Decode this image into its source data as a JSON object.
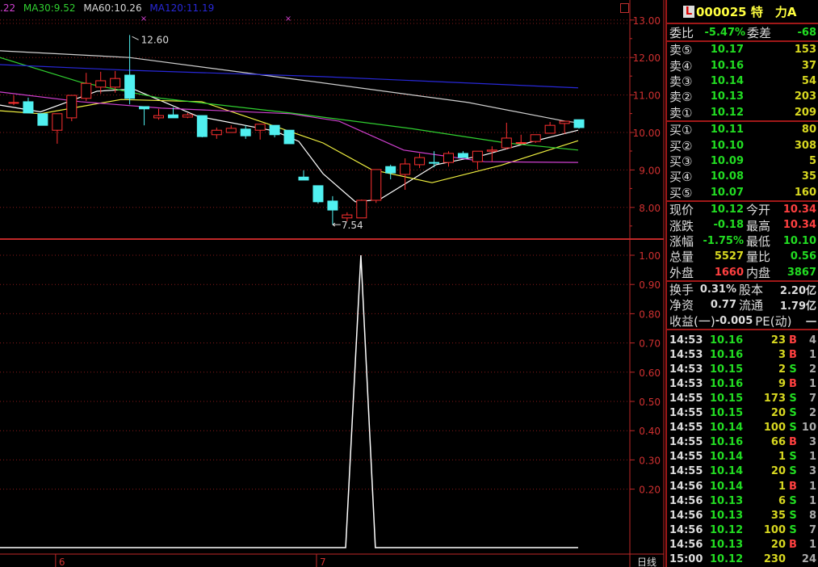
{
  "legend": [
    {
      "text": ".22",
      "color": "#d040d0"
    },
    {
      "text": "MA30:9.52",
      "color": "#30d030"
    },
    {
      "text": "MA60:10.26",
      "color": "#d8d8d8"
    },
    {
      "text": "MA120:11.19",
      "color": "#2020d0"
    }
  ],
  "colors": {
    "up": "#ff3030",
    "down": "#50f0f0",
    "axis": "#c02828",
    "grid": "#8a1a1a"
  },
  "chart_data": [
    {
      "type": "candlestick",
      "price_ticks": [
        "13.00",
        "12.00",
        "11.00",
        "10.00",
        "9.00",
        "8.00"
      ],
      "ylim": [
        7.3,
        13.5
      ],
      "x_labels": [
        {
          "text": "6",
          "index": 3
        },
        {
          "text": "7",
          "index": 21
        }
      ],
      "period_label": "日线",
      "high_marker": {
        "text": "12.60",
        "index": 8,
        "price": 12.6
      },
      "low_marker": {
        "text": "7.54",
        "index": 22,
        "price": 7.54
      },
      "candles": [
        [
          10.78,
          10.8,
          10.99,
          10.73
        ],
        [
          10.82,
          10.52,
          10.93,
          10.52
        ],
        [
          10.5,
          10.19,
          10.5,
          10.19
        ],
        [
          10.06,
          10.5,
          10.5,
          9.7
        ],
        [
          10.39,
          10.99,
          10.99,
          10.3
        ],
        [
          10.91,
          11.31,
          11.59,
          10.84
        ],
        [
          11.21,
          11.38,
          11.62,
          11.03
        ],
        [
          11.21,
          11.44,
          11.64,
          11.06
        ],
        [
          11.53,
          10.91,
          12.6,
          10.75
        ],
        [
          10.69,
          10.63,
          10.69,
          10.19
        ],
        [
          10.39,
          10.45,
          10.63,
          10.34
        ],
        [
          10.47,
          10.39,
          10.67,
          10.39
        ],
        [
          10.41,
          10.47,
          10.52,
          10.38
        ],
        [
          10.45,
          9.89,
          10.45,
          9.87
        ],
        [
          9.94,
          10.06,
          10.13,
          9.83
        ],
        [
          10.0,
          10.11,
          10.19,
          10.0
        ],
        [
          10.09,
          9.91,
          10.19,
          9.83
        ],
        [
          10.06,
          10.22,
          10.22,
          9.81
        ],
        [
          10.19,
          9.94,
          10.19,
          9.87
        ],
        [
          10.06,
          9.7,
          10.06,
          9.7
        ],
        [
          8.81,
          8.73,
          8.99,
          8.73
        ],
        [
          8.58,
          8.15,
          8.58,
          8.1
        ],
        [
          8.17,
          7.93,
          8.3,
          7.54
        ],
        [
          7.72,
          7.8,
          7.87,
          7.63
        ],
        [
          7.72,
          8.19,
          8.21,
          7.72
        ],
        [
          8.19,
          9.01,
          9.01,
          8.12
        ],
        [
          9.09,
          8.92,
          9.14,
          8.75
        ],
        [
          8.88,
          9.16,
          9.31,
          8.47
        ],
        [
          9.14,
          9.33,
          9.44,
          9.05
        ],
        [
          9.2,
          9.18,
          9.5,
          9.07
        ],
        [
          9.2,
          9.44,
          9.5,
          9.09
        ],
        [
          9.44,
          9.33,
          9.5,
          9.33
        ],
        [
          9.22,
          9.5,
          9.5,
          9.01
        ],
        [
          9.5,
          9.53,
          9.63,
          9.22
        ],
        [
          9.59,
          9.85,
          10.26,
          9.55
        ],
        [
          9.72,
          9.73,
          9.94,
          9.68
        ],
        [
          9.76,
          9.94,
          9.94,
          9.72
        ],
        [
          9.98,
          10.19,
          10.28,
          9.98
        ],
        [
          10.24,
          10.3,
          10.3,
          9.96
        ],
        [
          10.34,
          10.13,
          10.34,
          10.1
        ]
      ],
      "ma_series": [
        {
          "name": "MA5",
          "color": "#ffffff",
          "points": [
            [
              -0.95,
              10.73
            ],
            [
              1.84,
              10.55
            ],
            [
              5.74,
              11.1
            ],
            [
              8.25,
              11.16
            ],
            [
              12.7,
              10.43
            ],
            [
              18.0,
              10.04
            ],
            [
              19.67,
              9.76
            ],
            [
              21.34,
              8.9
            ],
            [
              23.57,
              8.15
            ],
            [
              25.24,
              8.21
            ],
            [
              29.14,
              9.14
            ],
            [
              32.48,
              9.4
            ],
            [
              35.82,
              9.76
            ],
            [
              38.94,
              10.06
            ]
          ]
        },
        {
          "name": "MA10",
          "color": "#f0f040",
          "points": [
            [
              -0.95,
              10.58
            ],
            [
              1.84,
              10.5
            ],
            [
              4.62,
              10.69
            ],
            [
              7.41,
              10.88
            ],
            [
              12.98,
              10.82
            ],
            [
              17.44,
              10.24
            ],
            [
              21.34,
              9.72
            ],
            [
              24.68,
              9.01
            ],
            [
              28.86,
              8.66
            ],
            [
              33.59,
              9.12
            ],
            [
              38.94,
              9.78
            ]
          ]
        },
        {
          "name": "MA20",
          "color": "#d040d0",
          "points": [
            [
              -0.95,
              11.08
            ],
            [
              4.62,
              10.82
            ],
            [
              10.2,
              10.65
            ],
            [
              19.1,
              10.5
            ],
            [
              22.45,
              10.3
            ],
            [
              26.9,
              9.53
            ],
            [
              32.48,
              9.22
            ],
            [
              38.94,
              9.2
            ]
          ]
        },
        {
          "name": "MA30",
          "color": "#30d030",
          "points": [
            [
              -0.95,
              12.0
            ],
            [
              4.62,
              11.34
            ],
            [
              10.2,
              10.91
            ],
            [
              19.1,
              10.52
            ],
            [
              27.5,
              10.1
            ],
            [
              33.98,
              9.72
            ],
            [
              38.94,
              9.53
            ]
          ]
        },
        {
          "name": "MA60",
          "color": "#d0d0d0",
          "points": [
            [
              -0.95,
              12.18
            ],
            [
              7.97,
              12.0
            ],
            [
              20.2,
              11.38
            ],
            [
              31.36,
              10.8
            ],
            [
              38.05,
              10.3
            ],
            [
              38.94,
              10.26
            ]
          ]
        },
        {
          "name": "MA120",
          "color": "#2828d8",
          "points": [
            [
              -0.95,
              11.81
            ],
            [
              7.97,
              11.66
            ],
            [
              21.34,
              11.49
            ],
            [
              38.94,
              11.19
            ]
          ]
        }
      ]
    },
    {
      "type": "line",
      "ticks": [
        "1.00",
        "0.90",
        "0.80",
        "0.70",
        "0.60",
        "0.50",
        "0.40",
        "0.30",
        "0.20"
      ],
      "ylim": [
        0,
        1.0
      ],
      "series": [
        {
          "name": "indicator",
          "color": "#ffffff",
          "points": [
            [
              -0.95,
              0
            ],
            [
              22.9,
              0
            ],
            [
              23.95,
              1.0
            ],
            [
              24.95,
              0
            ],
            [
              38.94,
              0
            ]
          ]
        }
      ]
    }
  ],
  "panel": {
    "logo": "L",
    "code": "000025 特　力A",
    "weibi_label": "委比",
    "weibi": "-5.47%",
    "weicha_label": "委差",
    "weicha": "-68",
    "sell": [
      {
        "label": "卖⑤",
        "price": "10.17",
        "vol": "153"
      },
      {
        "label": "卖④",
        "price": "10.16",
        "vol": "37"
      },
      {
        "label": "卖③",
        "price": "10.14",
        "vol": "54"
      },
      {
        "label": "卖②",
        "price": "10.13",
        "vol": "203"
      },
      {
        "label": "卖①",
        "price": "10.12",
        "vol": "209"
      }
    ],
    "buy": [
      {
        "label": "买①",
        "price": "10.11",
        "vol": "80"
      },
      {
        "label": "买②",
        "price": "10.10",
        "vol": "308"
      },
      {
        "label": "买③",
        "price": "10.09",
        "vol": "5"
      },
      {
        "label": "买④",
        "price": "10.08",
        "vol": "35"
      },
      {
        "label": "买⑤",
        "price": "10.07",
        "vol": "160"
      }
    ],
    "stats": [
      {
        "l1": "现价",
        "v1": "10.12",
        "c1": "g",
        "l2": "今开",
        "v2": "10.34",
        "c2": "r"
      },
      {
        "l1": "涨跌",
        "v1": "-0.18",
        "c1": "g",
        "l2": "最高",
        "v2": "10.34",
        "c2": "r"
      },
      {
        "l1": "涨幅",
        "v1": "-1.75%",
        "c1": "g",
        "l2": "最低",
        "v2": "10.10",
        "c2": "g"
      },
      {
        "l1": "总量",
        "v1": "5527",
        "c1": "y",
        "l2": "量比",
        "v2": "0.56",
        "c2": "g"
      },
      {
        "l1": "外盘",
        "v1": "1660",
        "c1": "r",
        "l2": "内盘",
        "v2": "3867",
        "c2": "g"
      }
    ],
    "fin": [
      {
        "l1": "换手",
        "v1": "0.31%",
        "l2": "股本",
        "v2": "2.20亿"
      },
      {
        "l1": "净资",
        "v1": "0.77",
        "l2": "流通",
        "v2": "1.79亿"
      },
      {
        "l1": "收益(一)",
        "v1": "-0.005",
        "l2": "PE(动)",
        "v2": "一"
      }
    ],
    "trades": [
      {
        "t": "14:53",
        "p": "10.16",
        "v": "23",
        "s": "B",
        "n": "4"
      },
      {
        "t": "14:53",
        "p": "10.16",
        "v": "3",
        "s": "B",
        "n": "1"
      },
      {
        "t": "14:53",
        "p": "10.15",
        "v": "2",
        "s": "S",
        "n": "2"
      },
      {
        "t": "14:53",
        "p": "10.16",
        "v": "9",
        "s": "B",
        "n": "1"
      },
      {
        "t": "14:55",
        "p": "10.15",
        "v": "173",
        "s": "S",
        "n": "7"
      },
      {
        "t": "14:55",
        "p": "10.15",
        "v": "20",
        "s": "S",
        "n": "2"
      },
      {
        "t": "14:55",
        "p": "10.14",
        "v": "100",
        "s": "S",
        "n": "10"
      },
      {
        "t": "14:55",
        "p": "10.16",
        "v": "66",
        "s": "B",
        "n": "3"
      },
      {
        "t": "14:55",
        "p": "10.14",
        "v": "1",
        "s": "S",
        "n": "1"
      },
      {
        "t": "14:55",
        "p": "10.14",
        "v": "20",
        "s": "S",
        "n": "3"
      },
      {
        "t": "14:56",
        "p": "10.14",
        "v": "1",
        "s": "B",
        "n": "1"
      },
      {
        "t": "14:56",
        "p": "10.13",
        "v": "6",
        "s": "S",
        "n": "1"
      },
      {
        "t": "14:56",
        "p": "10.13",
        "v": "35",
        "s": "S",
        "n": "8"
      },
      {
        "t": "14:56",
        "p": "10.12",
        "v": "100",
        "s": "S",
        "n": "7"
      },
      {
        "t": "14:56",
        "p": "10.13",
        "v": "20",
        "s": "B",
        "n": "1"
      },
      {
        "t": "15:00",
        "p": "10.12",
        "v": "230",
        "s": "",
        "n": "24"
      }
    ]
  }
}
